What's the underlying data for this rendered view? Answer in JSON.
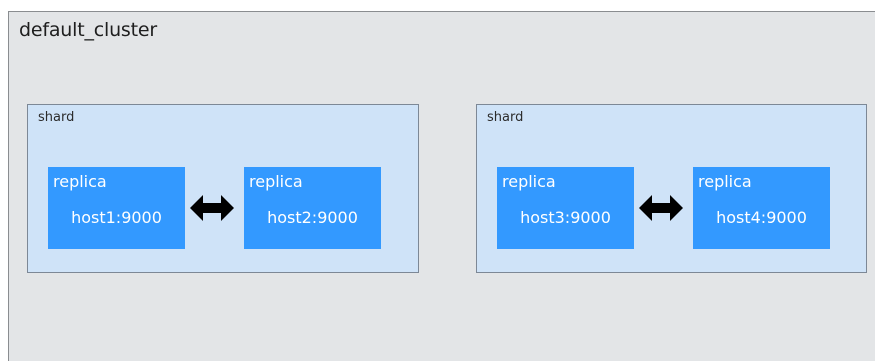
{
  "cluster": {
    "title": "default_cluster"
  },
  "shards": [
    {
      "label": "shard",
      "replicas": [
        {
          "label": "replica",
          "host": "host1:9000"
        },
        {
          "label": "replica",
          "host": "host2:9000"
        }
      ]
    },
    {
      "label": "shard",
      "replicas": [
        {
          "label": "replica",
          "host": "host3:9000"
        },
        {
          "label": "replica",
          "host": "host4:9000"
        }
      ]
    }
  ],
  "colors": {
    "cluster_bg": "#e3e5e7",
    "shard_bg": "#cfe3f8",
    "replica_bg": "#3399ff",
    "replica_text": "#ffffff",
    "arrow": "#000000"
  },
  "icons": {
    "replication": "double-arrow-icon"
  }
}
